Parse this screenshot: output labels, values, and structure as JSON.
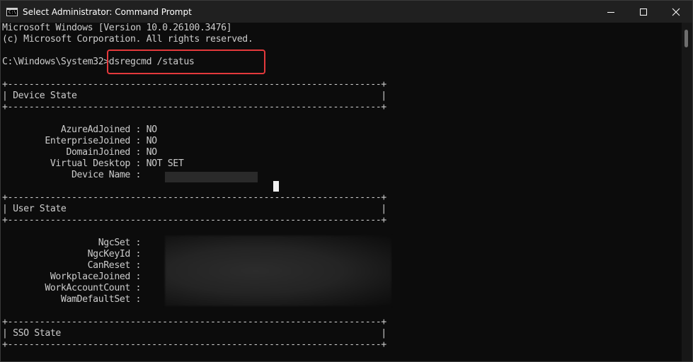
{
  "window": {
    "title": "Select Administrator: Command Prompt",
    "icon_label": "C:\\."
  },
  "controls": {
    "minimize": "minimize-icon",
    "maximize": "maximize-icon",
    "close": "close-icon"
  },
  "console": {
    "version_line": "Microsoft Windows [Version 10.0.26100.3476]",
    "copyright_line": "(c) Microsoft Corporation. All rights reserved.",
    "prompt": "C:\\Windows\\System32>",
    "command": "dsregcmd /status",
    "border_line": "+----------------------------------------------------------------------+",
    "sections": {
      "device_state": "| Device State                                                         |",
      "user_state": "| User State                                                           |",
      "sso_state": "| SSO State                                                            |"
    },
    "device_fields": [
      {
        "label": "           AzureAdJoined : ",
        "value": "NO"
      },
      {
        "label": "        EnterpriseJoined : ",
        "value": "NO"
      },
      {
        "label": "            DomainJoined : ",
        "value": "NO"
      },
      {
        "label": "         Virtual Desktop : ",
        "value": "NOT SET"
      },
      {
        "label": "             Device Name : ",
        "value": ""
      }
    ],
    "user_fields": [
      {
        "label": "                  NgcSet : ",
        "value": ""
      },
      {
        "label": "                NgcKeyId : ",
        "value": ""
      },
      {
        "label": "                CanReset : ",
        "value": ""
      },
      {
        "label": "         WorkplaceJoined : ",
        "value": ""
      },
      {
        "label": "        WorkAccountCount : ",
        "value": ""
      },
      {
        "label": "           WamDefaultSet : ",
        "value": ""
      }
    ]
  },
  "colors": {
    "console_bg": "#0c0c0c",
    "console_text": "#cccccc",
    "titlebar_bg": "#202020",
    "highlight": "#e4393c"
  }
}
